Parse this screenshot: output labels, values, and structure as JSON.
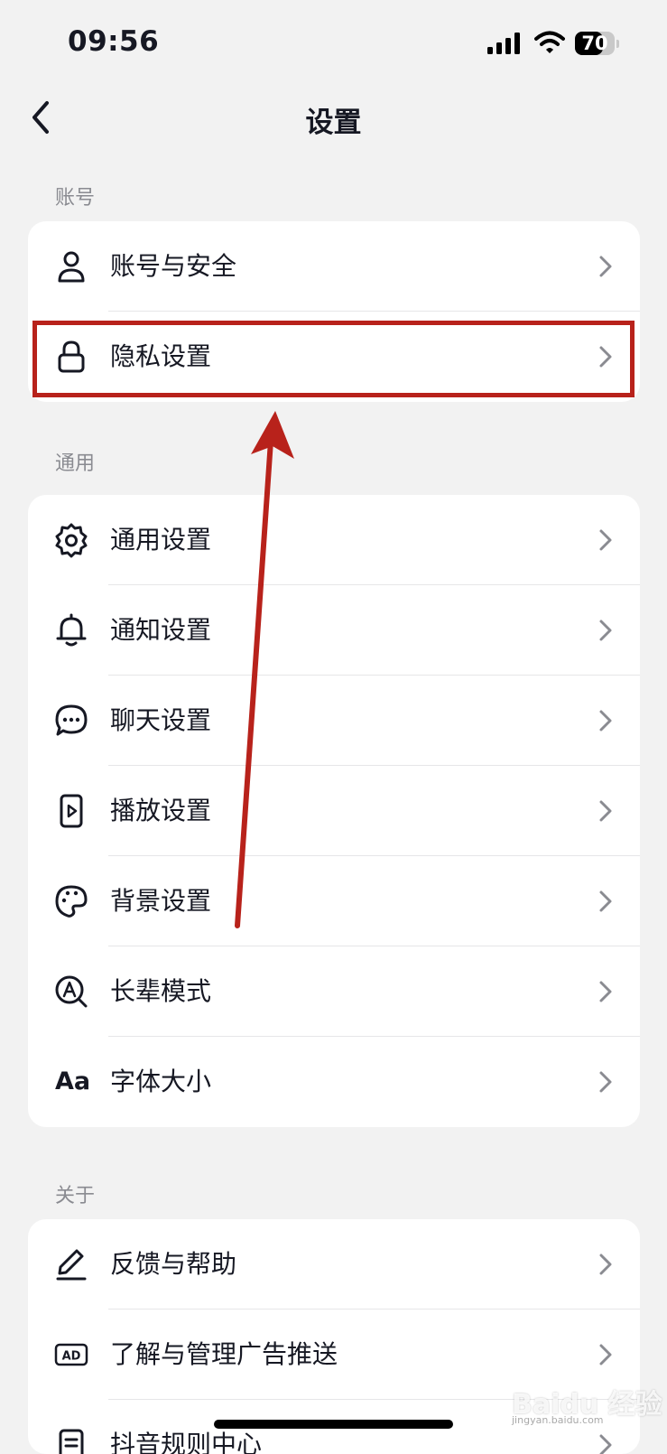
{
  "status_bar": {
    "time": "09:56",
    "battery_percent": "70",
    "battery_level": 0.7
  },
  "nav": {
    "title": "设置"
  },
  "sections": [
    {
      "title": "账号",
      "items": [
        {
          "label": "账号与安全",
          "icon": "person-icon"
        },
        {
          "label": "隐私设置",
          "icon": "lock-icon"
        }
      ]
    },
    {
      "title": "通用",
      "items": [
        {
          "label": "通用设置",
          "icon": "gear-icon"
        },
        {
          "label": "通知设置",
          "icon": "bell-icon"
        },
        {
          "label": "聊天设置",
          "icon": "chat-bubble-icon"
        },
        {
          "label": "播放设置",
          "icon": "play-icon"
        },
        {
          "label": "背景设置",
          "icon": "palette-icon"
        },
        {
          "label": "长辈模式",
          "icon": "magnifier-a-icon"
        },
        {
          "label": "字体大小",
          "icon": "font-size-icon",
          "icon_text": "Aa"
        }
      ]
    },
    {
      "title": "关于",
      "items": [
        {
          "label": "反馈与帮助",
          "icon": "pen-icon"
        },
        {
          "label": "了解与管理广告推送",
          "icon": "ad-icon",
          "icon_text": "AD"
        },
        {
          "label": "抖音规则中心",
          "icon": "document-icon"
        }
      ]
    }
  ],
  "annotation": {
    "color": "#b8221b",
    "highlighted_item": "隐私设置"
  },
  "watermark": {
    "text": "Baidu 经验",
    "subtext": "jingyan.baidu.com"
  },
  "colors": {
    "background": "#f2f2f2",
    "card": "#ffffff",
    "text": "#161823",
    "secondary_text": "#8a8b91",
    "annotation": "#b8221b"
  }
}
